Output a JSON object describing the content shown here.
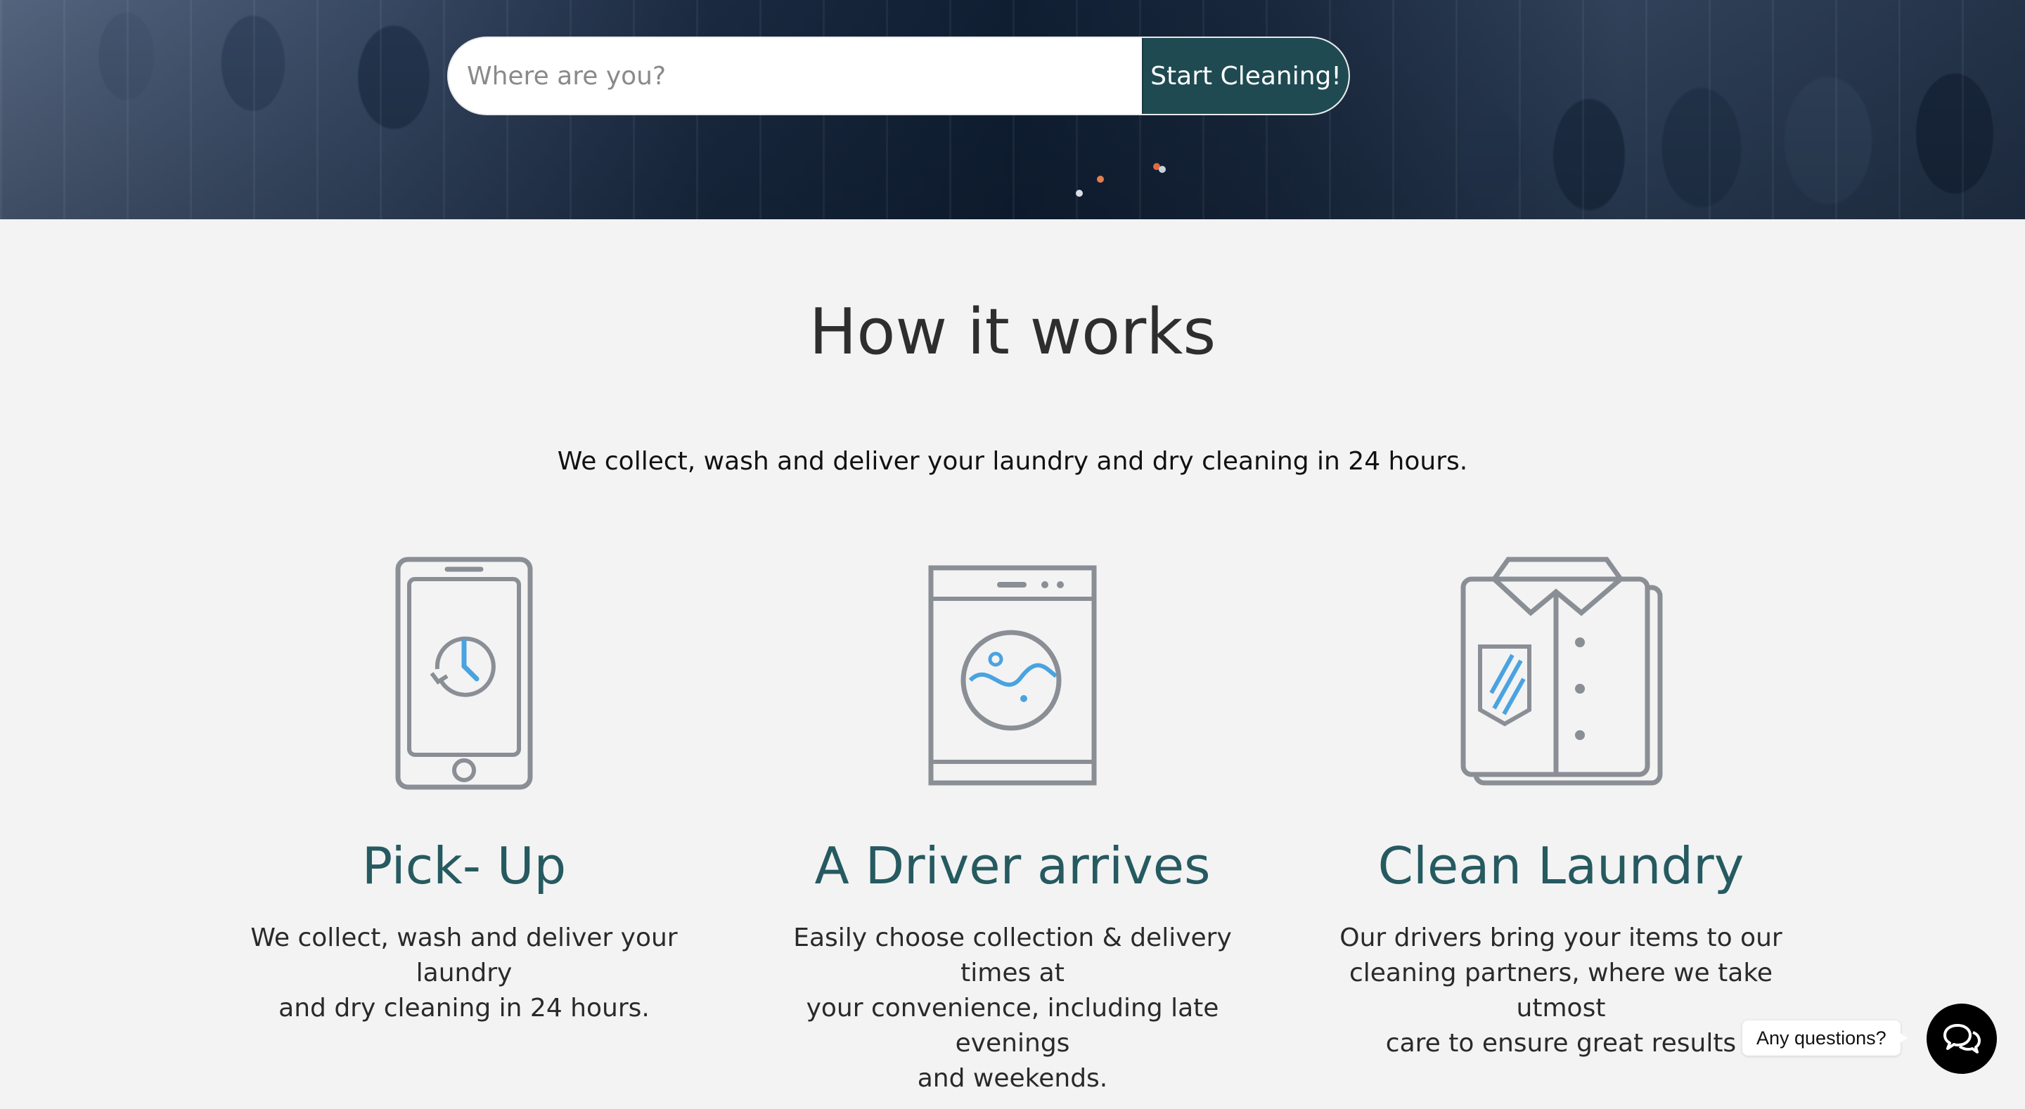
{
  "search": {
    "placeholder": "Where are you?",
    "button_label": "Start Cleaning!"
  },
  "how_it_works": {
    "title": "How it works",
    "subtitle": "We collect, wash and deliver your laundry and dry cleaning in 24 hours.",
    "steps": [
      {
        "icon": "phone-clock-icon",
        "title": "Pick- Up",
        "line1": "We collect, wash and deliver your laundry",
        "line2": "and dry cleaning in 24 hours."
      },
      {
        "icon": "washing-machine-icon",
        "title": "A Driver arrives",
        "line1": "Easily choose collection & delivery times at",
        "line2": "your convenience, including late evenings",
        "line3": "and weekends."
      },
      {
        "icon": "shirt-icon",
        "title": "Clean Laundry",
        "line1": "Our drivers bring your items to our",
        "line2": "cleaning partners, where we take utmost",
        "line3": "care to ensure great results"
      }
    ]
  },
  "chat": {
    "bubble_label": "Any questions?",
    "icon": "chat-icon"
  },
  "colors": {
    "accent": "#1f4a52",
    "heading_teal": "#255a60",
    "icon_gray": "#8a8e95",
    "icon_blue": "#4aa3e0"
  }
}
